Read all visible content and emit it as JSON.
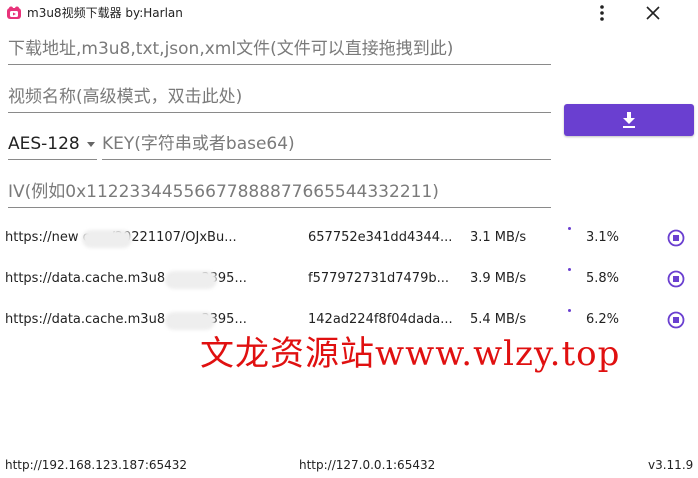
{
  "window": {
    "title": "m3u8视频下载器 by:Harlan"
  },
  "form": {
    "url_placeholder": "下载地址,m3u8,txt,json,xml文件(文件可以直接拖拽到此)",
    "name_placeholder": "视频名称(高级模式，双击此处)",
    "encryption_selected": "AES-128",
    "key_placeholder": "KEY(字符串或者base64)",
    "iv_placeholder": "IV(例如0x11223344556677888877665544332211)"
  },
  "colors": {
    "accent": "#6a3fd0",
    "watermark": "#e01010"
  },
  "tasks": [
    {
      "url": "https://new          com/20221107/OJxBu...",
      "hash": "657752e341dd4344...",
      "speed": "3.1 MB/s",
      "percent": "3.1%",
      "progress": 0.031
    },
    {
      "url": "https://data.cache.m3u8          com:3395...",
      "hash": "f577972731d7479b...",
      "speed": "3.9 MB/s",
      "percent": "5.8%",
      "progress": 0.058
    },
    {
      "url": "https://data.cache.m3u8          com:3395...",
      "hash": "142ad224f8f04dada...",
      "speed": "5.4 MB/s",
      "percent": "6.2%",
      "progress": 0.062
    }
  ],
  "watermark": "文龙资源站www.wlzy.top",
  "status": {
    "left": "http://192.168.123.187:65432",
    "middle": "http://127.0.0.1:65432",
    "version": "v3.11.9"
  }
}
